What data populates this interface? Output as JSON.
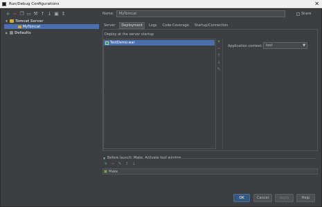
{
  "window": {
    "title": "Run/Debug Configurations",
    "close_glyph": "✕"
  },
  "left_toolbar": [
    {
      "name": "add-config-icon",
      "glyph": "+"
    },
    {
      "name": "remove-config-icon",
      "glyph": "−"
    },
    {
      "name": "copy-config-icon",
      "glyph": "❐"
    },
    {
      "name": "save-config-icon",
      "glyph": "▭"
    },
    {
      "name": "edit-defaults-icon",
      "glyph": "⚒"
    },
    {
      "name": "move-up-icon",
      "glyph": "↑"
    },
    {
      "name": "move-down-icon",
      "glyph": "↓"
    },
    {
      "name": "folder-icon",
      "glyph": "▣"
    },
    {
      "name": "sort-icon",
      "glyph": "↕"
    }
  ],
  "tree": {
    "tomcat_server": "Tomcat Server",
    "my_tomcat": "MyTomcat",
    "defaults": "Defaults"
  },
  "form": {
    "name_label": "Name:",
    "name_value": "MyTomcat",
    "share_label": "Share"
  },
  "tabs": [
    "Server",
    "Deployment",
    "Logs",
    "Code Coverage",
    "Startup/Connection"
  ],
  "active_tab": "Deployment",
  "deployment": {
    "section_label": "Deploy at the server startup",
    "items": [
      "TestDemo:war"
    ],
    "app_context_label": "Application context:",
    "app_context_value": "test",
    "side_tools": [
      {
        "name": "add-artifact-icon",
        "glyph": "+",
        "cls": "add"
      },
      {
        "name": "remove-artifact-icon",
        "glyph": "−",
        "cls": "remove"
      },
      {
        "name": "move-up-icon",
        "glyph": "↑",
        "cls": ""
      },
      {
        "name": "move-down-icon",
        "glyph": "↓",
        "cls": ""
      },
      {
        "name": "edit-artifact-icon",
        "glyph": "✎",
        "cls": ""
      }
    ]
  },
  "before_launch": {
    "label": "Before launch: Make, Activate tool window",
    "tools": [
      {
        "name": "add-task-icon",
        "glyph": "+",
        "cls": "add"
      },
      {
        "name": "remove-task-icon",
        "glyph": "−",
        "cls": "remove"
      },
      {
        "name": "edit-task-icon",
        "glyph": "✎",
        "cls": ""
      },
      {
        "name": "move-up-icon",
        "glyph": "↑",
        "cls": ""
      },
      {
        "name": "move-down-icon",
        "glyph": "↓",
        "cls": ""
      }
    ],
    "items": [
      "Make"
    ]
  },
  "buttons": {
    "ok": "OK",
    "cancel": "Cancel",
    "apply": "Apply",
    "help": "Help"
  }
}
